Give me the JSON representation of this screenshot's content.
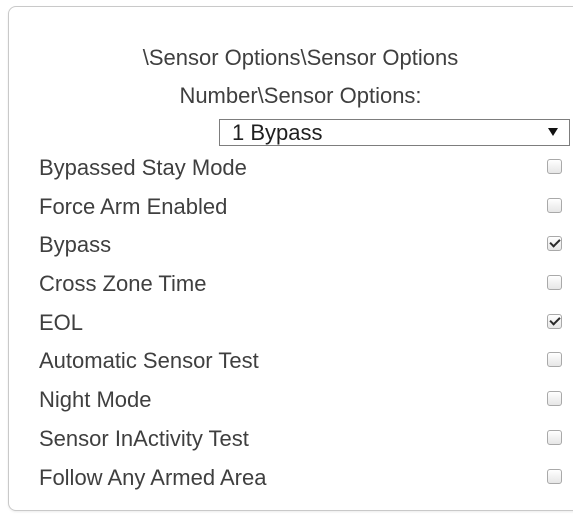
{
  "panel": {
    "title_line_1": "\\Sensor Options\\Sensor Options",
    "title_line_2": "Number\\Sensor Options:"
  },
  "select": {
    "selected": "1 Bypass"
  },
  "options": [
    {
      "label": "Bypassed Stay Mode",
      "checked": false
    },
    {
      "label": "Force Arm Enabled",
      "checked": false
    },
    {
      "label": "Bypass",
      "checked": true
    },
    {
      "label": "Cross Zone Time",
      "checked": false
    },
    {
      "label": "EOL",
      "checked": true
    },
    {
      "label": "Automatic Sensor Test",
      "checked": false
    },
    {
      "label": "Night Mode",
      "checked": false
    },
    {
      "label": "Sensor InActivity Test",
      "checked": false
    },
    {
      "label": "Follow Any Armed Area",
      "checked": false
    }
  ]
}
